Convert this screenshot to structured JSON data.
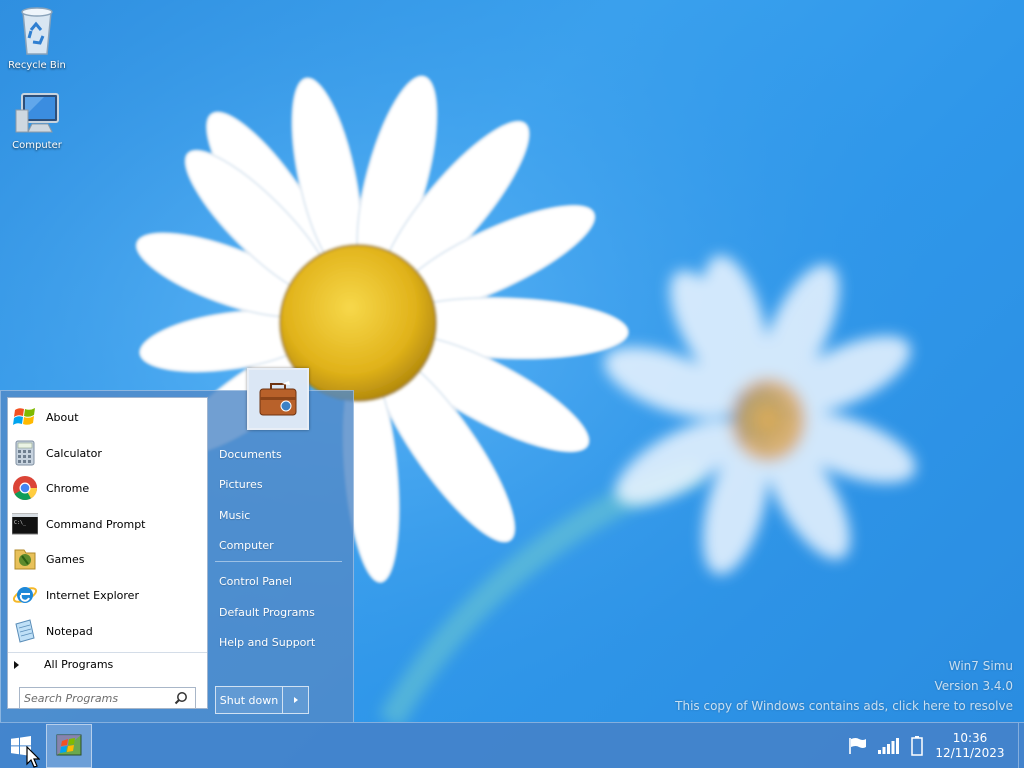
{
  "desktop": {
    "icons": [
      {
        "label": "Recycle Bin",
        "icon": "recycle-bin-icon"
      },
      {
        "label": "Computer",
        "icon": "computer-icon"
      }
    ],
    "watermark": {
      "line1": "Win7 Simu",
      "line2": "Version 3.4.0",
      "line3": "This copy of Windows contains ads, click here to resolve"
    }
  },
  "start_menu": {
    "programs": [
      {
        "label": "About",
        "icon": "windows-flag-icon"
      },
      {
        "label": "Calculator",
        "icon": "calculator-icon"
      },
      {
        "label": "Chrome",
        "icon": "chrome-icon"
      },
      {
        "label": "Command Prompt",
        "icon": "command-prompt-icon"
      },
      {
        "label": "Games",
        "icon": "games-icon"
      },
      {
        "label": "Internet Explorer",
        "icon": "internet-explorer-icon"
      },
      {
        "label": "Notepad",
        "icon": "notepad-icon"
      }
    ],
    "all_programs_label": "All Programs",
    "search": {
      "placeholder": "Search Programs",
      "value": ""
    },
    "user_picture": "briefcase-icon",
    "right_links": [
      {
        "label": "Documents"
      },
      {
        "label": "Pictures"
      },
      {
        "label": "Music"
      },
      {
        "label": "Computer"
      },
      {
        "label": "Control Panel"
      },
      {
        "label": "Default Programs"
      },
      {
        "label": "Help and Support"
      }
    ],
    "shutdown_label": "Shut down"
  },
  "taskbar": {
    "start_icon": "windows-logo-icon",
    "pinned_app_icon": "win7-simu-app-icon",
    "tray_icons": [
      "action-center-flag-icon",
      "signal-bars-icon",
      "battery-icon"
    ],
    "clock": {
      "time": "10:36",
      "date": "12/11/2023"
    }
  },
  "colors": {
    "accent": "#528ac8",
    "taskbar": "#4682c8",
    "desktop_bg": "#3399e8"
  }
}
